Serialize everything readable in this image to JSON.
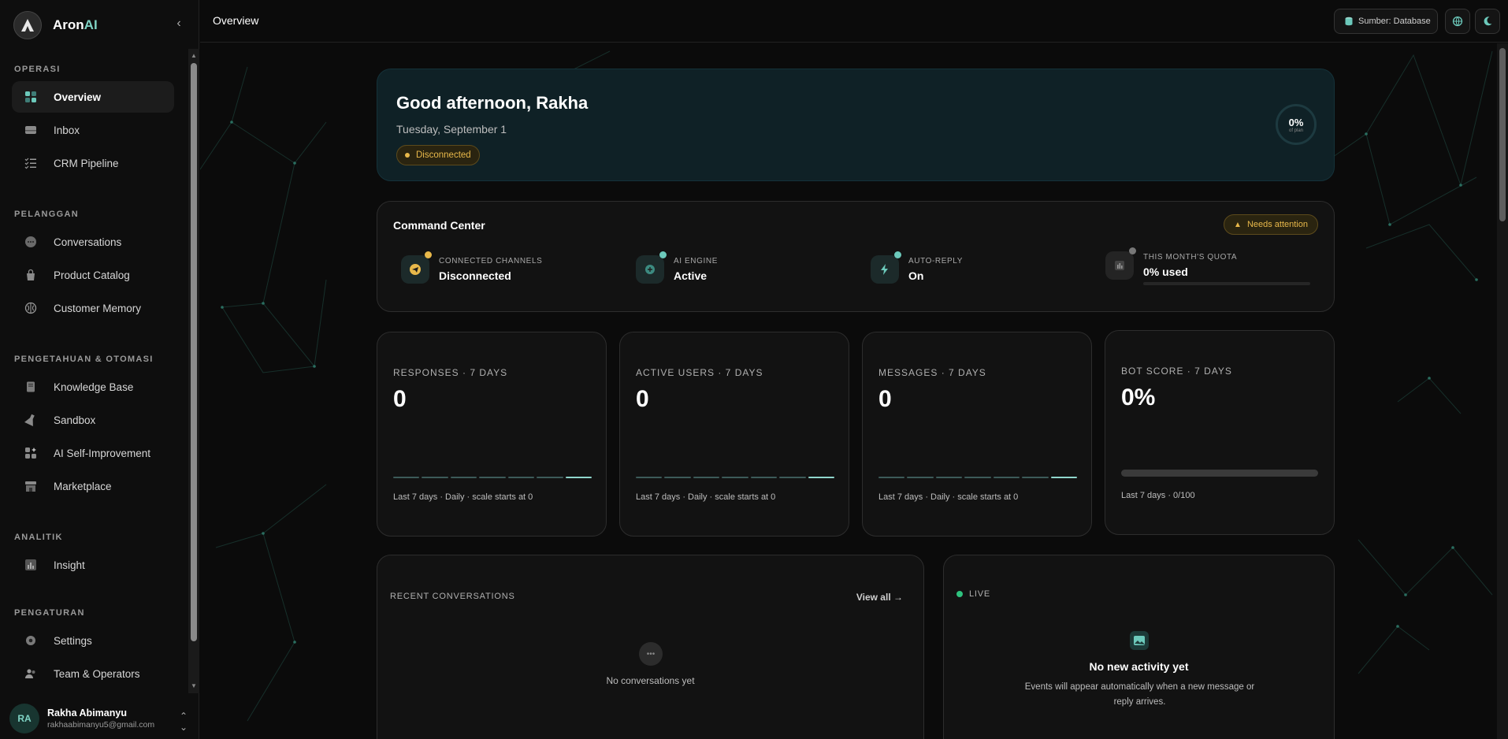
{
  "app": {
    "brand_prefix": "Aron",
    "brand_suffix": "AI",
    "accent": "#7fd3c4"
  },
  "sidebar": {
    "sections": [
      {
        "title": "OPERASI",
        "items": [
          {
            "label": "Overview",
            "icon": "dashboard-icon",
            "active": true
          },
          {
            "label": "Inbox",
            "icon": "inbox-icon"
          },
          {
            "label": "CRM Pipeline",
            "icon": "list-check-icon"
          }
        ]
      },
      {
        "title": "PELANGGAN",
        "items": [
          {
            "label": "Conversations",
            "icon": "chat-icon"
          },
          {
            "label": "Product Catalog",
            "icon": "shopping-bag-icon"
          },
          {
            "label": "Customer Memory",
            "icon": "brain-icon"
          }
        ]
      },
      {
        "title": "PENGETAHUAN & OTOMASI",
        "items": [
          {
            "label": "Knowledge Base",
            "icon": "book-icon"
          },
          {
            "label": "Sandbox",
            "icon": "flask-icon"
          },
          {
            "label": "AI Self-Improvement",
            "icon": "sparkle-grid-icon"
          },
          {
            "label": "Marketplace",
            "icon": "store-icon"
          }
        ]
      },
      {
        "title": "ANALITIK",
        "items": [
          {
            "label": "Insight",
            "icon": "bar-chart-icon"
          }
        ]
      },
      {
        "title": "PENGATURAN",
        "items": [
          {
            "label": "Settings",
            "icon": "gear-icon"
          },
          {
            "label": "Team & Operators",
            "icon": "users-icon"
          }
        ]
      }
    ],
    "user": {
      "initials": "RA",
      "name": "Rakha Abimanyu",
      "email": "rakhaabimanyu5@gmail.com"
    }
  },
  "topbar": {
    "title": "Overview",
    "source_label": "Sumber: Database"
  },
  "hero": {
    "greeting": "Good afternoon, Rakha",
    "date": "Tuesday, September 1",
    "status": "Disconnected",
    "ring_value": "0%",
    "ring_sub": "of plan"
  },
  "command_center": {
    "title": "Command Center",
    "attention": "Needs attention",
    "items": [
      {
        "label": "CONNECTED CHANNELS",
        "value": "Disconnected",
        "icon": "send-icon",
        "dot": "#e8b84a"
      },
      {
        "label": "AI ENGINE",
        "value": "Active",
        "icon": "ai-chip-icon",
        "dot": "#6cc9bb"
      },
      {
        "label": "AUTO-REPLY",
        "value": "On",
        "icon": "bolt-icon",
        "dot": "#6cc9bb"
      },
      {
        "label": "THIS MONTH'S QUOTA",
        "value": "0% used",
        "icon": "bar-chart-icon",
        "dot": "#777777",
        "progress": 0
      }
    ]
  },
  "stats": [
    {
      "label": "RESPONSES · 7 DAYS",
      "value": "0",
      "foot": "Last 7 days · Daily · scale starts at 0",
      "series": [
        0,
        0,
        0,
        0,
        0,
        0,
        0
      ]
    },
    {
      "label": "ACTIVE USERS · 7 DAYS",
      "value": "0",
      "foot": "Last 7 days · Daily · scale starts at 0",
      "series": [
        0,
        0,
        0,
        0,
        0,
        0,
        0
      ]
    },
    {
      "label": "MESSAGES · 7 DAYS",
      "value": "0",
      "foot": "Last 7 days · Daily · scale starts at 0",
      "series": [
        0,
        0,
        0,
        0,
        0,
        0,
        0
      ]
    },
    {
      "label": "BOT SCORE · 7 DAYS",
      "value": "0%",
      "foot": "Last 7 days · 0/100",
      "progress": 0
    }
  ],
  "recent": {
    "title": "RECENT CONVERSATIONS",
    "view_all": "View all",
    "empty": "No conversations yet"
  },
  "live": {
    "tag": "LIVE",
    "title": "No new activity yet",
    "desc": "Events will appear automatically when a new message or reply arrives."
  }
}
